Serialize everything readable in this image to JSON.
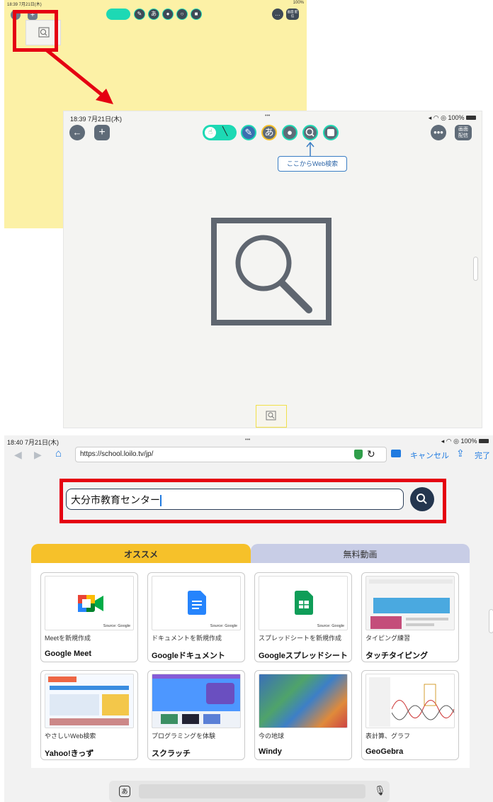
{
  "shot1": {
    "status_time": "18:39 7月21日(木)",
    "status_right": "100%",
    "screen_share": "画面\n配信"
  },
  "shot2": {
    "status_time": "18:39  7月21日(木)",
    "status_dots": "•••",
    "status_right": "100%",
    "screen_share_line1": "画面",
    "screen_share_line2": "配信",
    "text_tool": "あ",
    "tooltip": "ここからWeb検索"
  },
  "shot3": {
    "status_time": "18:40  7月21日(木)",
    "status_dots": "•••",
    "status_right": "100%",
    "url": "https://school.loilo.tv/jp/",
    "cancel": "キャンセル",
    "done": "完了",
    "search_value": "大分市教育センター",
    "tabs": [
      "オススメ",
      "無料動画"
    ],
    "source_label": "Source: Google",
    "cards": [
      {
        "sub": "Meetを新規作成",
        "title": "Google Meet"
      },
      {
        "sub": "ドキュメントを新規作成",
        "title": "Googleドキュメント"
      },
      {
        "sub": "スプレッドシートを新規作成",
        "title": "Googleスプレッドシート"
      },
      {
        "sub": "タイピング練習",
        "title": "タッチタイピング"
      },
      {
        "sub": "やさしいWeb検索",
        "title": "Yahoo!きっず"
      },
      {
        "sub": "プログラミングを体験",
        "title": "スクラッチ"
      },
      {
        "sub": "今の地球",
        "title": "Windy"
      },
      {
        "sub": "表計算、グラフ",
        "title": "GeoGebra"
      }
    ],
    "kbd_key": "あ"
  },
  "colors": {
    "highlight_red": "#e50012",
    "teal_tool": "#1dd9b4",
    "navy": "#24364f",
    "tab_yellow": "#f6c12a",
    "tab_lavender": "#c8cde6"
  }
}
